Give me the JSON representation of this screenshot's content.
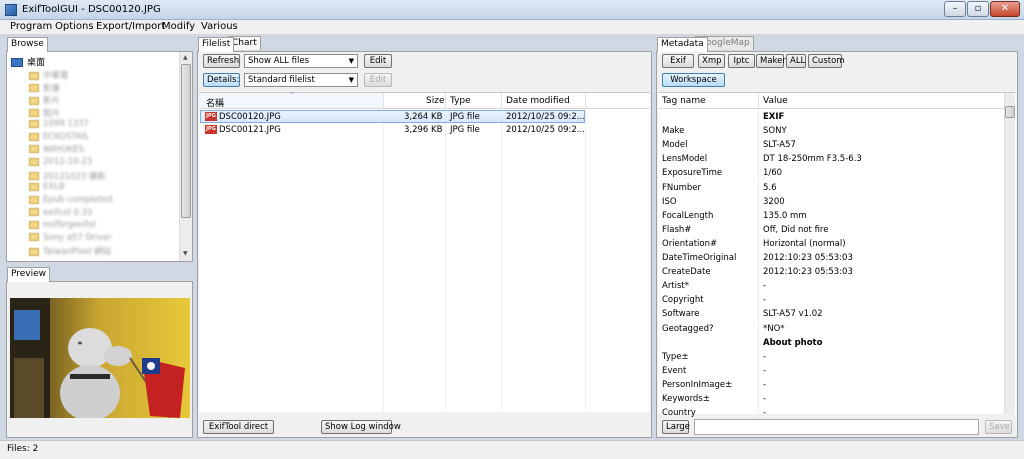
{
  "window": {
    "title": "ExifToolGUI - DSC00120.JPG",
    "controls": {
      "minimize": "–",
      "maximize": "▫",
      "close": "✕"
    }
  },
  "menu": [
    "Program",
    "Options",
    "Export/Import",
    "Modify",
    "Various"
  ],
  "left": {
    "browse_tab": "Browse",
    "desktop_label": "桌面",
    "tree_items_blurred": [
      "中華電",
      "影像",
      "影片",
      "照片",
      "1099 1337",
      "ECKOSTAIL",
      "WAYOKES",
      "2012-10-23",
      "20121023 攝影",
      "EXLB",
      "Epub completed",
      "exifcol 0.33",
      "exifbrgexifol",
      "Sony a57 Driver",
      "TaiwanPixel 網站"
    ],
    "preview_tab": "Preview"
  },
  "middle": {
    "tabs": [
      "Filelist",
      "Chart"
    ],
    "refresh_button": "Refresh",
    "filter_combo": "Show ALL files",
    "edit_button_1": "Edit",
    "details_button": "Details:",
    "filelist_combo": "Standard filelist",
    "edit_button_2": "Edit",
    "columns": {
      "name": "名稱",
      "size": "Size",
      "type": "Type",
      "date": "Date modified"
    },
    "files": [
      {
        "name": "DSC00120.JPG",
        "size": "3,264 KB",
        "type": "JPG file",
        "date": "2012/10/25 09:2..."
      },
      {
        "name": "DSC00121.JPG",
        "size": "3,296 KB",
        "type": "JPG file",
        "date": "2012/10/25 09:2..."
      }
    ],
    "exiftool_direct": "ExifTool direct",
    "show_log": "Show Log window"
  },
  "right": {
    "tabs": [
      "Metadata",
      "GoogleMap"
    ],
    "buttons": [
      "Exif",
      "Xmp",
      "Iptc",
      "Maker",
      "ALL",
      "Custom"
    ],
    "workspace_button": "Workspace",
    "columns": {
      "tag": "Tag name",
      "value": "Value"
    },
    "rows": [
      {
        "tag": "",
        "value": "EXIF",
        "bold": true
      },
      {
        "tag": "Make",
        "value": "SONY"
      },
      {
        "tag": "Model",
        "value": "SLT-A57"
      },
      {
        "tag": "LensModel",
        "value": "DT 18-250mm F3.5-6.3"
      },
      {
        "tag": "ExposureTime",
        "value": "1/60"
      },
      {
        "tag": "FNumber",
        "value": "5.6"
      },
      {
        "tag": "ISO",
        "value": "3200"
      },
      {
        "tag": "FocalLength",
        "value": "135.0 mm"
      },
      {
        "tag": "Flash#",
        "value": "Off, Did not fire"
      },
      {
        "tag": "Orientation#",
        "value": "Horizontal (normal)"
      },
      {
        "tag": "DateTimeOriginal",
        "value": "2012:10:23 05:53:03"
      },
      {
        "tag": "CreateDate",
        "value": "2012:10:23 05:53:03"
      },
      {
        "tag": "Artist*",
        "value": "-"
      },
      {
        "tag": "Copyright",
        "value": "-"
      },
      {
        "tag": "Software",
        "value": "SLT-A57 v1.02"
      },
      {
        "tag": "Geotagged?",
        "value": "*NO*"
      },
      {
        "tag": "",
        "value": "About photo",
        "bold": true
      },
      {
        "tag": "Type±",
        "value": "-"
      },
      {
        "tag": "Event",
        "value": "-"
      },
      {
        "tag": "PersonInImage±",
        "value": "-"
      },
      {
        "tag": "Keywords±",
        "value": "-"
      },
      {
        "tag": "Country",
        "value": "-"
      }
    ],
    "large_button": "Large",
    "save_button": "Save"
  },
  "status": {
    "files": "Files: 2"
  },
  "colors": {
    "selection": "#d5e8f9",
    "selection_border": "#84acdd",
    "panel": "#f0f0f0",
    "frame": "#cfd8e3"
  }
}
